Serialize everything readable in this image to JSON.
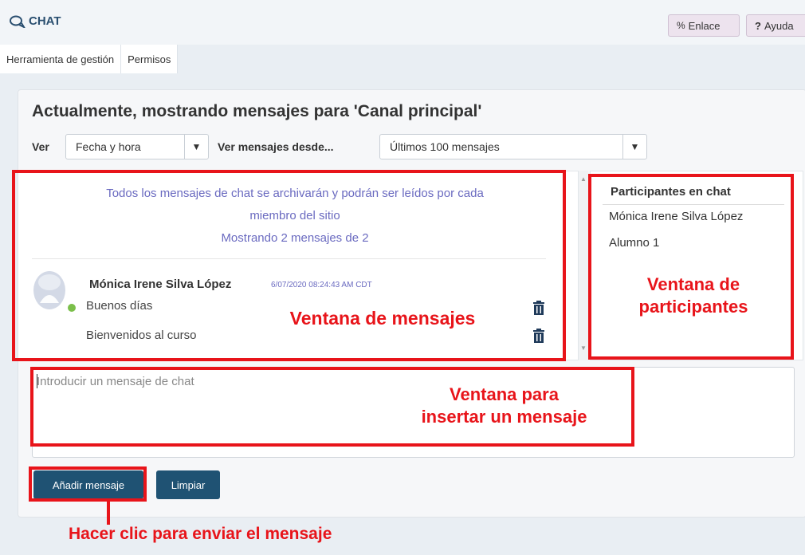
{
  "header": {
    "title": "CHAT",
    "link_label": "Enlace",
    "help_label": "Ayuda",
    "help_prefix": "?"
  },
  "tabs": [
    {
      "label": "Herramienta de gestión"
    },
    {
      "label": "Permisos"
    }
  ],
  "main": {
    "heading": "Actualmente, mostrando mensajes para 'Canal principal'",
    "view_label": "Ver",
    "view_value": "Fecha y hora",
    "from_label": "Ver mensajes desde...",
    "from_value": "Últimos 100 mensajes"
  },
  "messages": {
    "info_line1": "Todos los mensajes de chat se archivarán y podrán ser leídos por cada",
    "info_line2": "miembro del sitio",
    "info_line3": "Mostrando 2 mensajes de 2",
    "author": "Mónica Irene Silva López",
    "timestamp": "6/07/2020 08:24:43 AM CDT",
    "items": [
      {
        "text": "Buenos días"
      },
      {
        "text": "Bienvenidos al curso"
      }
    ]
  },
  "participants": {
    "title": "Participantes en chat",
    "items": [
      {
        "name": "Mónica Irene Silva López"
      },
      {
        "name": "Alumno 1"
      }
    ]
  },
  "compose": {
    "placeholder": "Introducir un mensaje de chat"
  },
  "buttons": {
    "add_label": "Añadir mensaje",
    "clear_label": "Limpiar"
  },
  "annotations": {
    "messages_window": "Ventana de mensajes",
    "participants_window_line1": "Ventana de",
    "participants_window_line2": "participantes",
    "insert_window_line1": "Ventana para",
    "insert_window_line2": "insertar un mensaje",
    "click_hint": "Hacer clic para enviar el mensaje"
  },
  "colors": {
    "annotation_red": "#e8141a",
    "button_blue": "#1f5273",
    "info_purple": "#6a6ac0",
    "online_green": "#7bbf4a"
  },
  "icons": [
    "chat-bubbles-icon",
    "link-icon",
    "trash-icon",
    "avatar-icon",
    "dropdown-arrow-icon"
  ]
}
